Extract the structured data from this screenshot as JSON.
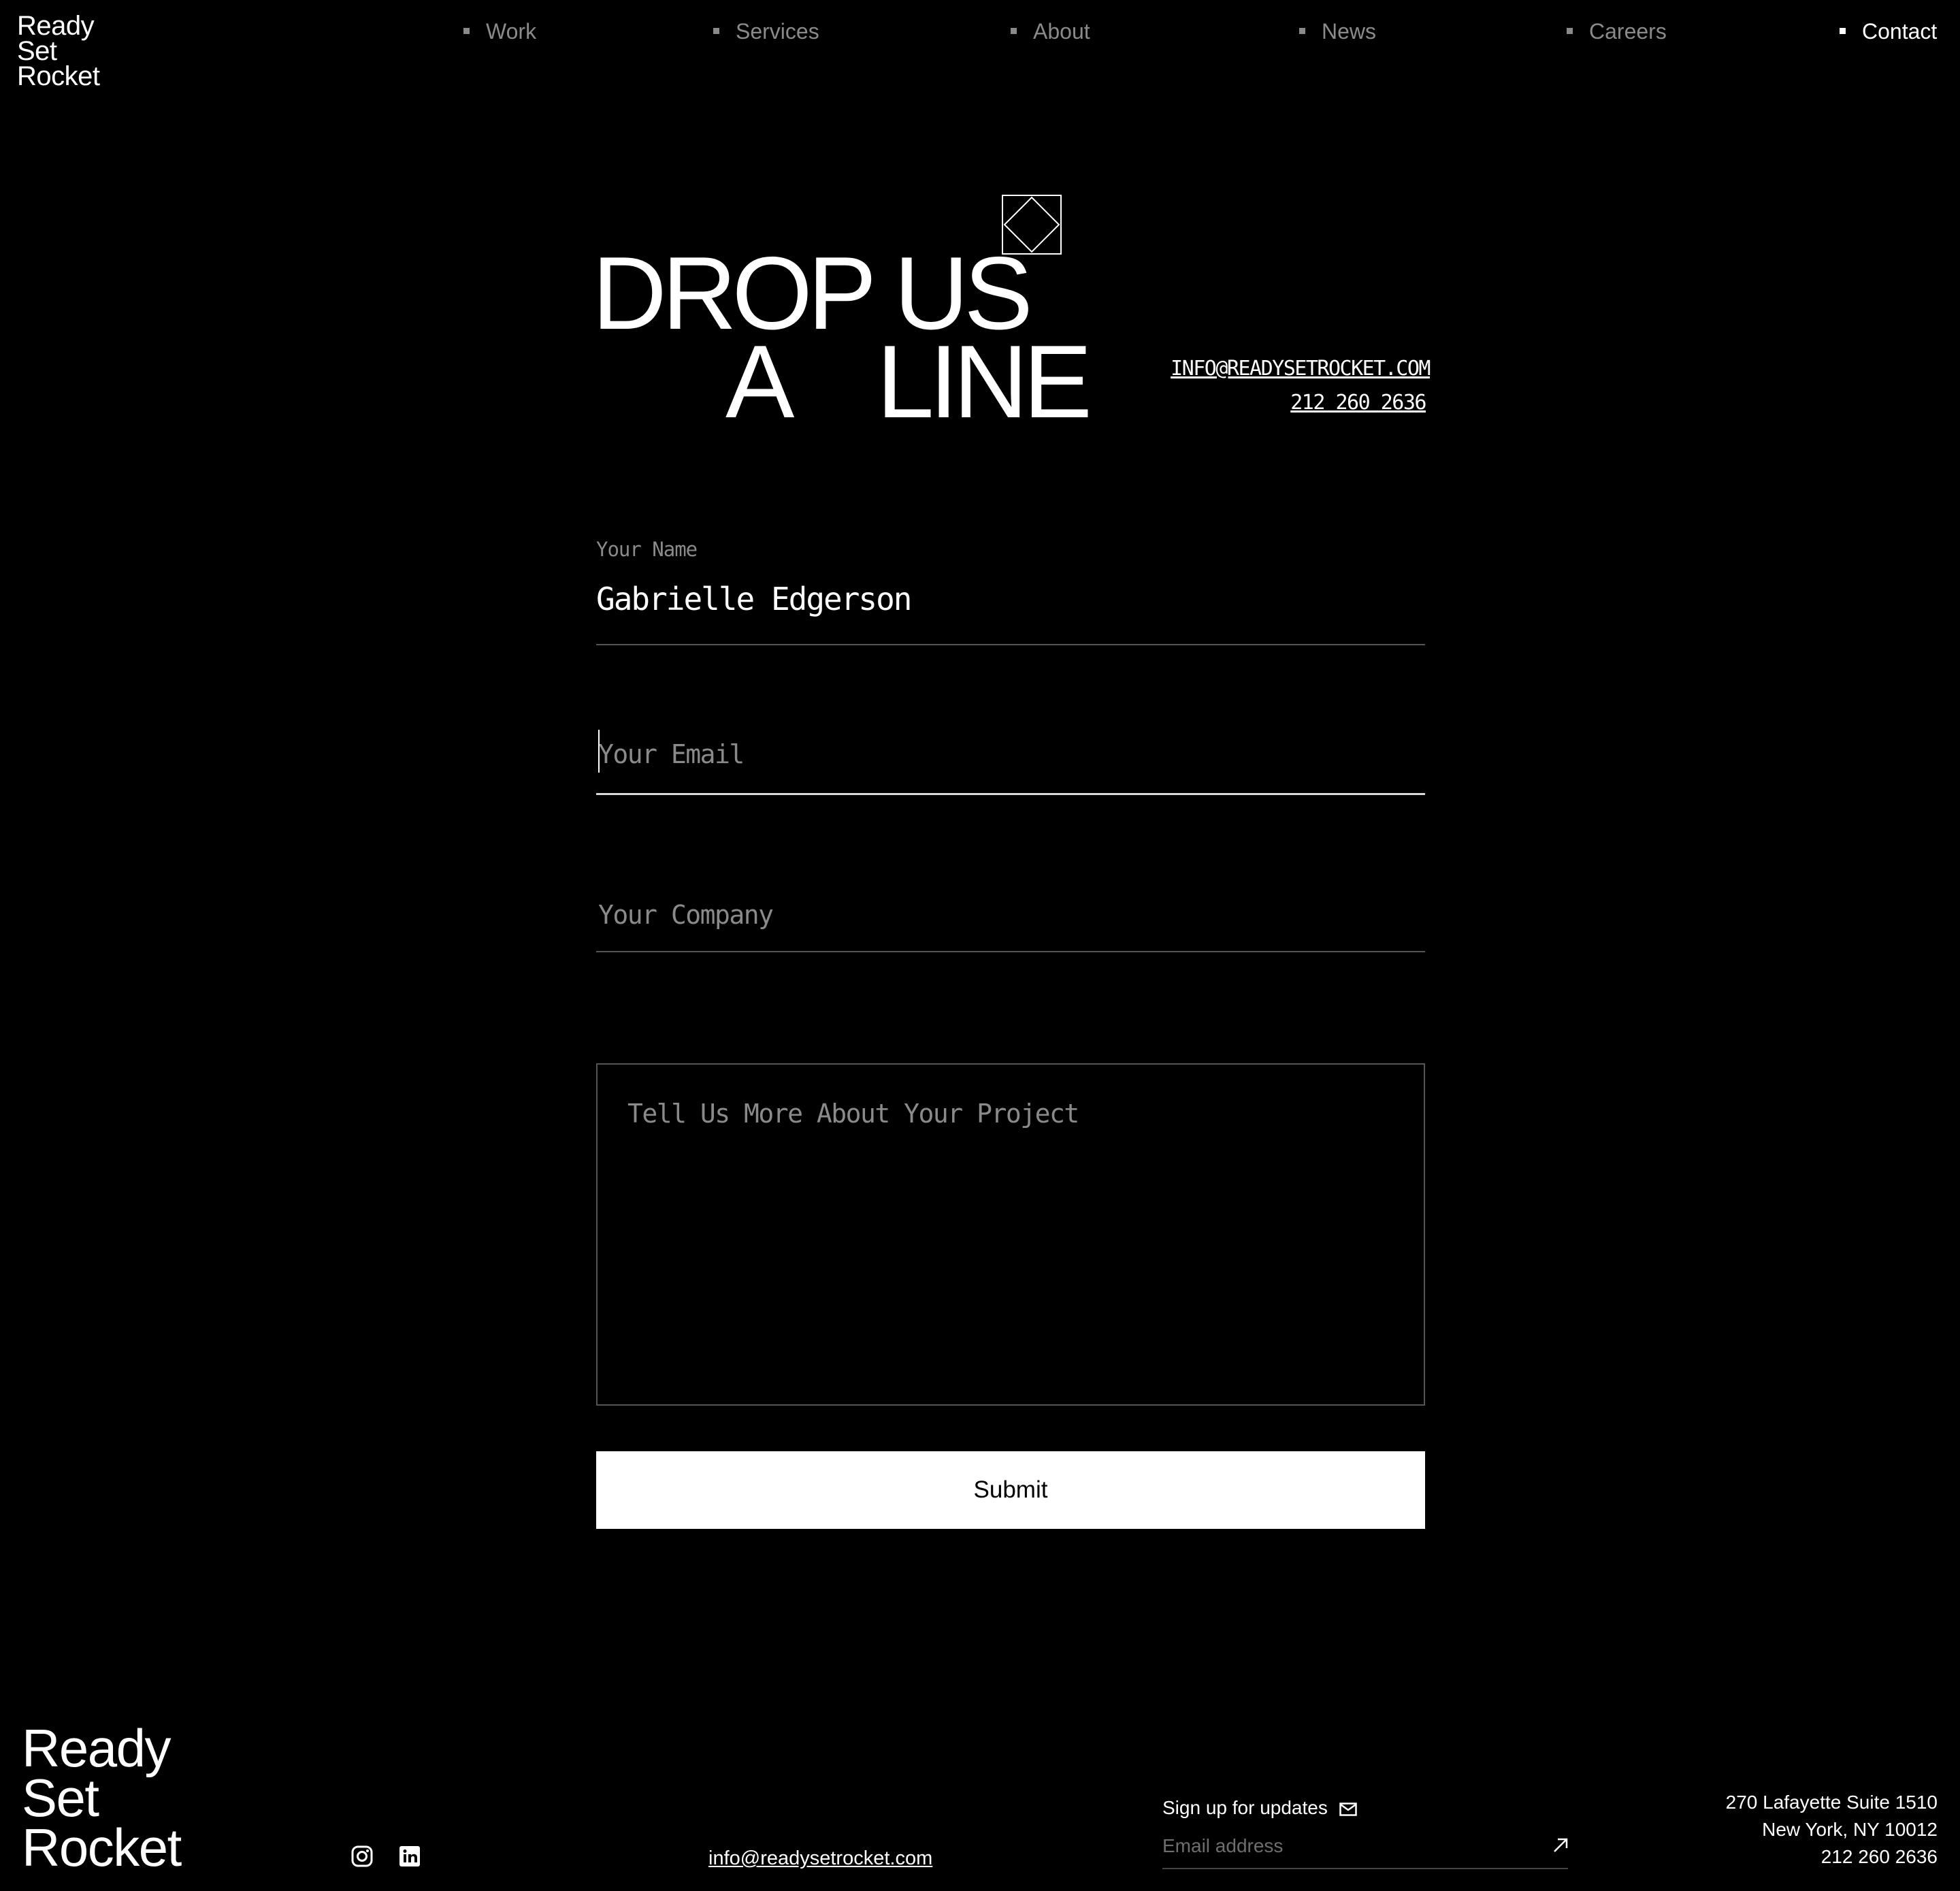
{
  "header": {
    "logo": [
      "Ready",
      "Set",
      "Rocket"
    ],
    "nav": [
      {
        "label": "Work",
        "active": false
      },
      {
        "label": "Services",
        "active": false
      },
      {
        "label": "About",
        "active": false
      },
      {
        "label": "News",
        "active": false
      },
      {
        "label": "Careers",
        "active": false
      },
      {
        "label": "Contact",
        "active": true
      }
    ]
  },
  "hero": {
    "line1": "DROP US",
    "line2_left": "A",
    "line2_right": "LINE",
    "email": "INFO@READYSETROCKET.COM",
    "phone": "212 260 2636"
  },
  "form": {
    "name_label": "Your Name",
    "name_value": "Gabrielle Edgerson",
    "email_placeholder": "Your Email",
    "company_placeholder": "Your Company",
    "project_placeholder": "Tell Us More About Your Project",
    "submit_label": "Submit"
  },
  "footer": {
    "logo": [
      "Ready",
      "Set",
      "Rocket"
    ],
    "social": [
      "instagram-icon",
      "linkedin-icon"
    ],
    "email": "info@readysetrocket.com",
    "signup_label": "Sign up for updates",
    "signup_placeholder": "Email address",
    "address": [
      "270 Lafayette Suite 1510",
      "New York, NY 10012",
      "212 260 2636"
    ]
  }
}
